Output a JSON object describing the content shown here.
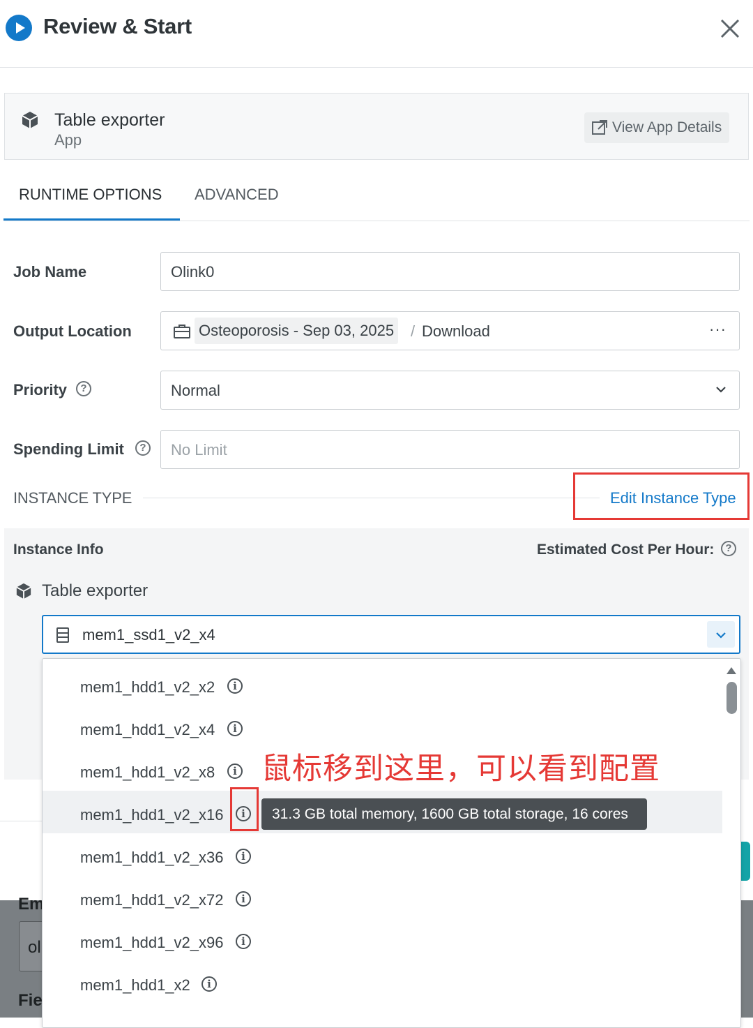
{
  "header": {
    "title": "Review & Start"
  },
  "app": {
    "name": "Table exporter",
    "type": "App",
    "view_details_label": "View App Details"
  },
  "tabs": [
    {
      "label": "RUNTIME OPTIONS",
      "active": true
    },
    {
      "label": "ADVANCED",
      "active": false
    }
  ],
  "form": {
    "job_name": {
      "label": "Job Name",
      "value": "Olink0"
    },
    "output_location": {
      "label": "Output Location",
      "project": "Osteoporosis - Sep 03, 2025",
      "separator": "/",
      "folder": "Download",
      "more": "···"
    },
    "priority": {
      "label": "Priority",
      "value": "Normal"
    },
    "spending_limit": {
      "label": "Spending Limit",
      "placeholder": "No Limit"
    }
  },
  "instance": {
    "section_title": "INSTANCE TYPE",
    "edit_label": "Edit Instance Type",
    "info_label": "Instance Info",
    "cost_label": "Estimated Cost Per Hour:",
    "app_name": "Table exporter",
    "selected": "mem1_ssd1_v2_x4",
    "options": [
      "mem1_hdd1_v2_x2",
      "mem1_hdd1_v2_x4",
      "mem1_hdd1_v2_x8",
      "mem1_hdd1_v2_x16",
      "mem1_hdd1_v2_x36",
      "mem1_hdd1_v2_x72",
      "mem1_hdd1_v2_x96",
      "mem1_hdd1_x2"
    ],
    "hovered_option": "mem1_hdd1_v2_x16",
    "tooltip": "31.3 GB total memory, 1600 GB total storage, 16 cores"
  },
  "annotation": "鼠标移到这里，可以看到配置",
  "background_text": {
    "t1": "Em",
    "t2": "ol",
    "t3": "Fie"
  },
  "colors": {
    "accent": "#1379c9",
    "annotation": "#e53935",
    "teal": "#14a3a7"
  }
}
